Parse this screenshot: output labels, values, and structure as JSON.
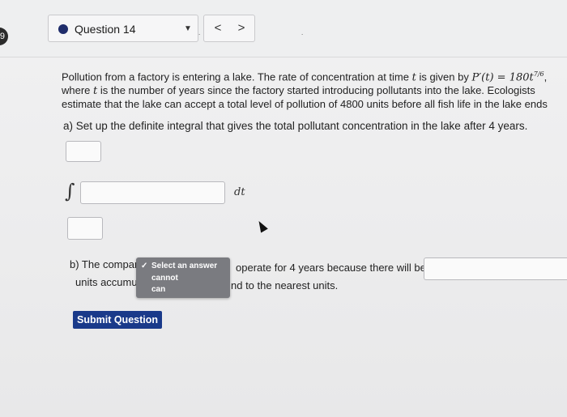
{
  "header": {
    "question_number_badge": "9",
    "question_select_label": "Question 14",
    "prev_label": "<",
    "next_label": ">",
    "caret_glyph": "▼",
    "stray_dot": "."
  },
  "question": {
    "line1_text": "Pollution from a factory is entering a lake. The rate of concentration at time ",
    "line1_var": "t",
    "line1_mid": " is given by ",
    "line1_formula": "P′(t) = 180t",
    "line1_exponent": "7/6",
    "line1_end": ",",
    "line2_text_a": "where ",
    "line2_var": "t",
    "line2_text_b": " is the number of years since the factory started introducing pollutants into the lake. Ecologists",
    "line3_text": "estimate that the lake can accept a total level of pollution of 4800 units before all fish life in the lake ends",
    "part_a": "a) Set up the definite integral that gives the total pollutant concentration in the lake after 4 years.",
    "integral_symbol": "∫",
    "dt_label": "dt",
    "part_b_left_1": "b) The compan",
    "part_b_left_2": "units accumul",
    "part_b_right_1": "operate for 4 years because there will be",
    "part_b_right_2": "nd to the nearest units."
  },
  "dropdown": {
    "check_glyph": "✓",
    "options": [
      "Select an answer",
      "cannot",
      "can"
    ]
  },
  "submit_label": "Submit Question"
}
